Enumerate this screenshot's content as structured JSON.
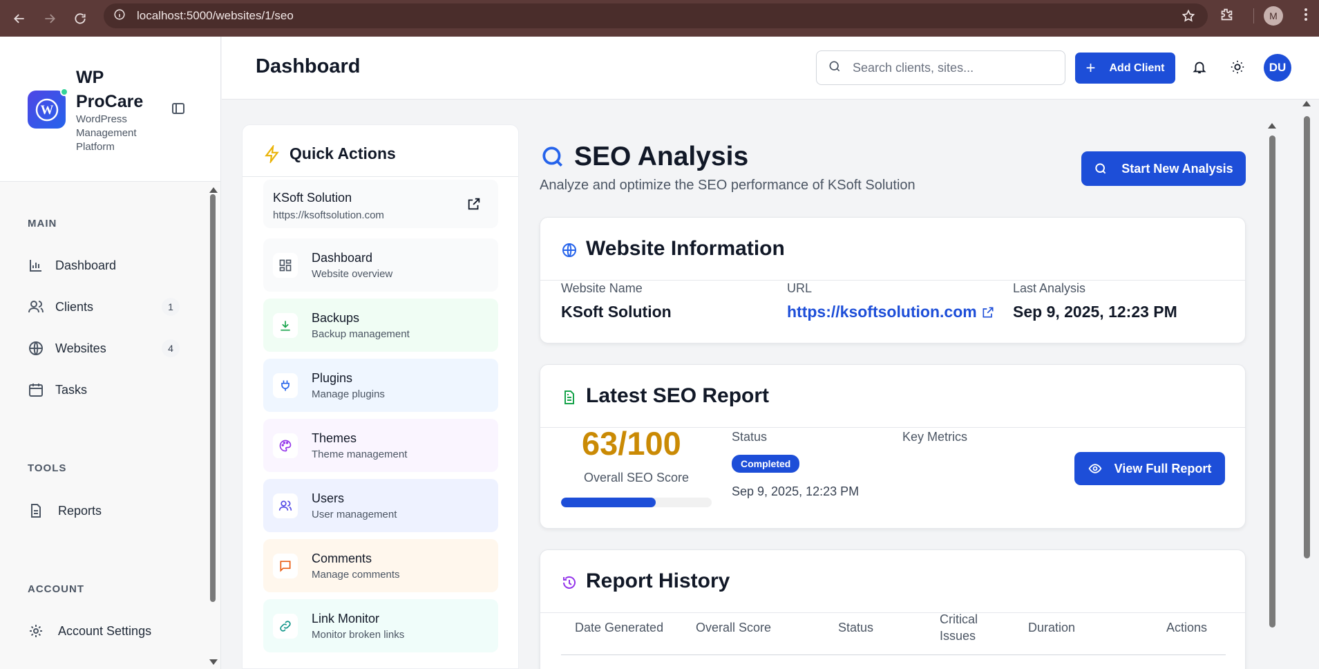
{
  "browser": {
    "url": "localhost:5000/websites/1/seo",
    "profile_initial": "M"
  },
  "sidebar": {
    "brand_name": "WP ProCare",
    "brand_sub": "WordPress Management Platform",
    "sections": {
      "main": "MAIN",
      "tools": "TOOLS",
      "account": "ACCOUNT"
    },
    "items": [
      {
        "label": "Dashboard",
        "icon": "bar-chart-icon"
      },
      {
        "label": "Clients",
        "icon": "users-icon",
        "badge": "1"
      },
      {
        "label": "Websites",
        "icon": "globe-icon",
        "badge": "4"
      },
      {
        "label": "Tasks",
        "icon": "calendar-icon"
      },
      {
        "label": "Reports",
        "icon": "file-icon"
      },
      {
        "label": "Account Settings",
        "icon": "gear-icon"
      }
    ]
  },
  "header": {
    "title": "Dashboard",
    "search_placeholder": "Search clients, sites...",
    "add_client": "Add Client",
    "avatar": "DU"
  },
  "quick_actions": {
    "title": "Quick Actions",
    "site_name": "KSoft Solution",
    "site_url": "https://ksoftsolution.com",
    "items": [
      {
        "title": "Dashboard",
        "sub": "Website overview",
        "bg": "#f9fafb",
        "color": "#4b5563"
      },
      {
        "title": "Backups",
        "sub": "Backup management",
        "bg": "#f0fdf4",
        "color": "#16a34a"
      },
      {
        "title": "Plugins",
        "sub": "Manage plugins",
        "bg": "#eff6ff",
        "color": "#2563eb"
      },
      {
        "title": "Themes",
        "sub": "Theme management",
        "bg": "#faf5ff",
        "color": "#9333ea"
      },
      {
        "title": "Users",
        "sub": "User management",
        "bg": "#eef2ff",
        "color": "#4f46e5"
      },
      {
        "title": "Comments",
        "sub": "Manage comments",
        "bg": "#fff7ed",
        "color": "#ea580c"
      },
      {
        "title": "Link Monitor",
        "sub": "Monitor broken links",
        "bg": "#f0fdfa",
        "color": "#0d9488"
      }
    ]
  },
  "seo": {
    "title": "SEO Analysis",
    "subtitle": "Analyze and optimize the SEO performance of KSoft Solution",
    "start_button": "Start New Analysis"
  },
  "website_info": {
    "title": "Website Information",
    "name_label": "Website Name",
    "name_value": "KSoft Solution",
    "url_label": "URL",
    "url_value": "https://ksoftsolution.com",
    "last_label": "Last Analysis",
    "last_value": "Sep 9, 2025, 12:23 PM"
  },
  "latest_report": {
    "title": "Latest SEO Report",
    "score": "63/100",
    "score_fraction": 0.63,
    "score_label": "Overall SEO Score",
    "status_label": "Status",
    "status_value": "Completed",
    "date": "Sep 9, 2025, 12:23 PM",
    "metrics_label": "Key Metrics",
    "view_button": "View Full Report"
  },
  "history": {
    "title": "Report History",
    "columns": [
      "Date Generated",
      "Overall Score",
      "Status",
      "Critical Issues",
      "Duration",
      "Actions"
    ]
  }
}
